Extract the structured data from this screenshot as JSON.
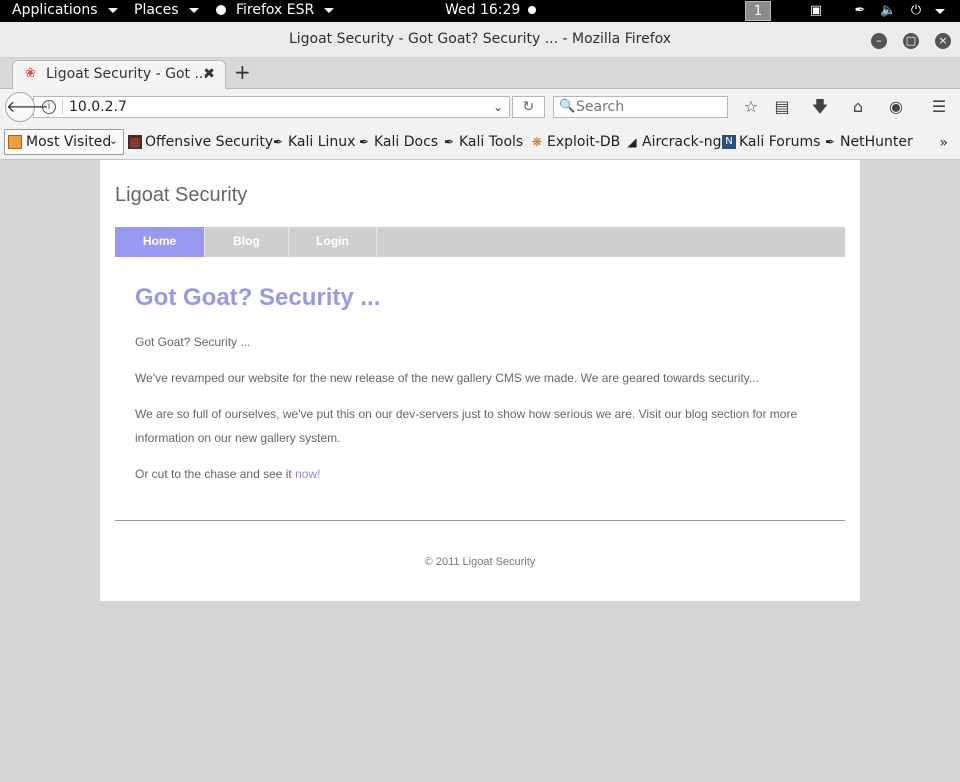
{
  "topbar": {
    "applications": "Applications",
    "places": "Places",
    "firefox": "Firefox ESR",
    "clock": "Wed 16:29",
    "workspace": "1"
  },
  "window": {
    "title": "Ligoat Security - Got Goat? Security ... - Mozilla Firefox"
  },
  "tab": {
    "title": "Ligoat Security - Got ..."
  },
  "navbar": {
    "url": "10.0.2.7",
    "search_placeholder": "Search"
  },
  "bookmarks": {
    "most_visited": "Most Visited",
    "items": [
      {
        "label": "Offensive Security"
      },
      {
        "label": "Kali Linux"
      },
      {
        "label": "Kali Docs"
      },
      {
        "label": "Kali Tools"
      },
      {
        "label": "Exploit-DB"
      },
      {
        "label": "Aircrack-ng"
      },
      {
        "label": "Kali Forums"
      },
      {
        "label": "NetHunter"
      }
    ]
  },
  "site": {
    "title": "Ligoat Security",
    "menu": [
      {
        "label": "Home",
        "active": true
      },
      {
        "label": "Blog",
        "active": false
      },
      {
        "label": "Login",
        "active": false
      }
    ],
    "heading": "Got Goat? Security ...",
    "para1": "Got Goat? Security ...",
    "para2": "We've revamped our website for the new release of the new gallery CMS we made. We are geared towards security...",
    "para3": "We are so full of ourselves, we've put this on our dev-servers just to show how serious we are. Visit our blog section for more information on our new gallery system.",
    "para4_prefix": "Or cut to the chase and see it ",
    "para4_link": "now!",
    "footer": "© 2011 Ligoat Security"
  },
  "colors": {
    "accent": "#9999f2",
    "link": "#8b8be8"
  }
}
